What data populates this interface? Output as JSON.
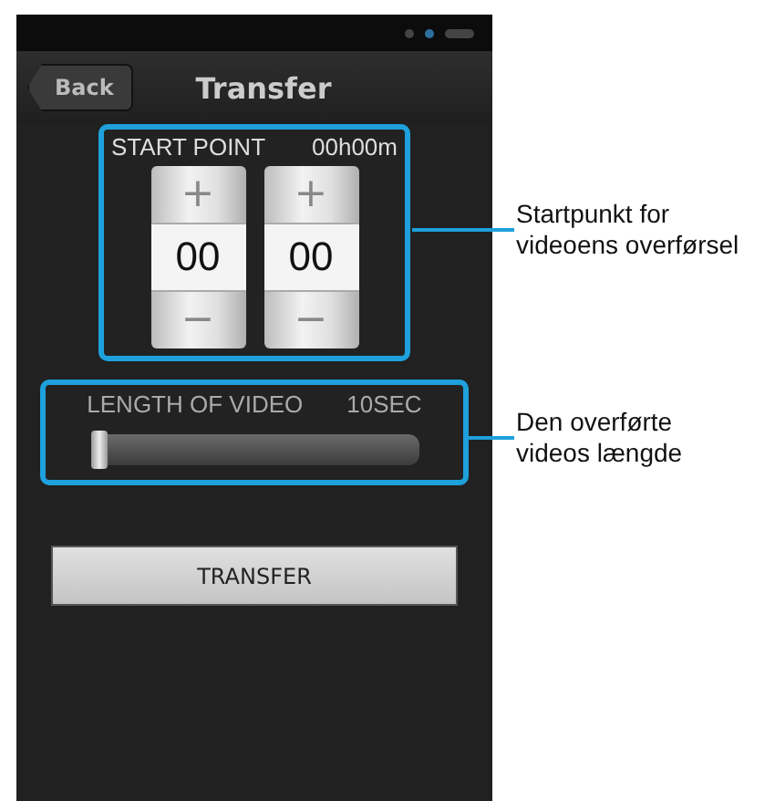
{
  "header": {
    "back_button": "Back",
    "title": "Transfer"
  },
  "start_point": {
    "label": "START POINT",
    "value": "00h00m",
    "steppers": [
      {
        "increment": "+",
        "value": "00",
        "decrement": "−"
      },
      {
        "increment": "+",
        "value": "00",
        "decrement": "−"
      }
    ]
  },
  "length_of_video": {
    "label": "LENGTH OF VIDEO",
    "value": "10SEC",
    "level": 0.0
  },
  "transfer_button": "TRANSFER",
  "callouts": [
    {
      "text": "Startpunkt for videoens overførsel"
    },
    {
      "text": "Den overførte videos længde"
    }
  ]
}
